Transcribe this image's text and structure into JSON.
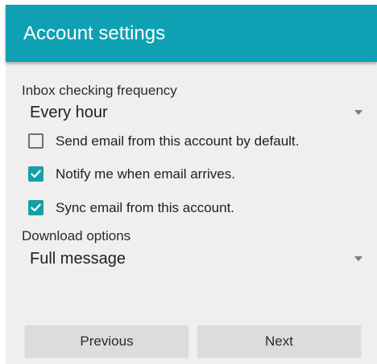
{
  "header": {
    "title": "Account settings"
  },
  "inbox_frequency": {
    "label": "Inbox checking frequency",
    "selected": "Every hour"
  },
  "checkboxes": [
    {
      "label": "Send email from this account by default.",
      "checked": false
    },
    {
      "label": "Notify me when email arrives.",
      "checked": true
    },
    {
      "label": "Sync email from this account.",
      "checked": true
    }
  ],
  "download_options": {
    "label": "Download options",
    "selected": "Full message"
  },
  "buttons": {
    "previous": "Previous",
    "next": "Next"
  },
  "colors": {
    "appbar": "#0fa0b3",
    "checkbox_accent": "#16a0a6",
    "background": "#efefef",
    "button": "#dcdcdc"
  },
  "icons": {
    "dropdown": "triangle-down",
    "checkmark": "check"
  }
}
